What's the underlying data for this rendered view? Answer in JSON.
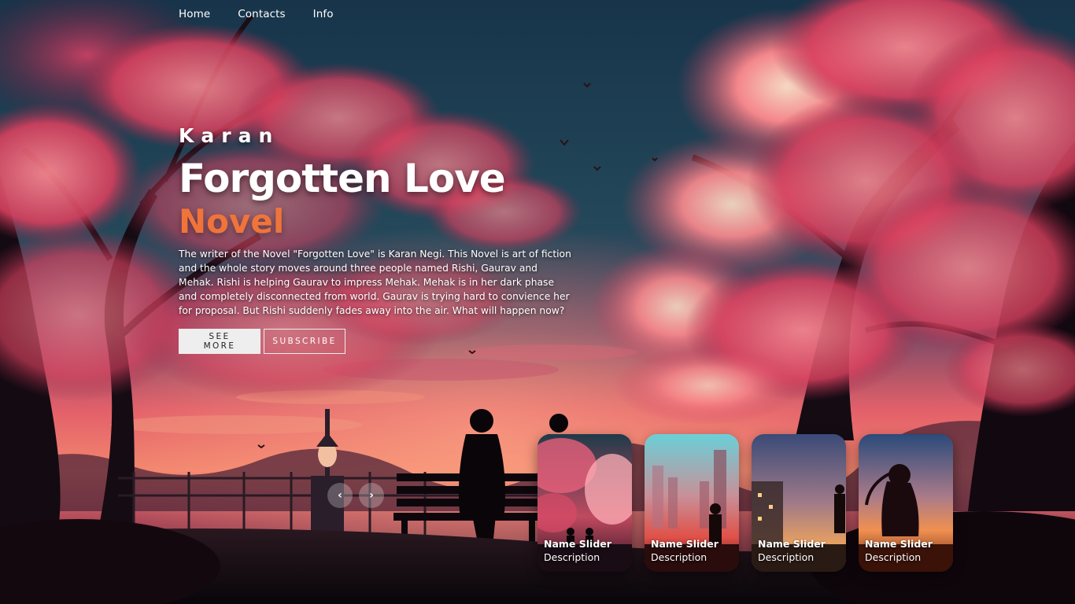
{
  "nav": {
    "items": [
      {
        "label": "Home"
      },
      {
        "label": "Contacts"
      },
      {
        "label": "Info"
      }
    ]
  },
  "hero": {
    "author": "Karan",
    "title": "Forgotten Love",
    "topic": "Novel",
    "description": "The writer of the Novel \"Forgotten Love\" is Karan Negi. This Novel is art of fiction and the whole story moves around three people named Rishi, Gaurav and Mehak. Rishi is helping Gaurav to impress Mehak. Mehak is in her dark phase and completely disconnected from world. Gaurav is trying hard to convience her for proposal. But Rishi suddenly fades away into the air. What will happen now?",
    "see_more_label": "SEE MORE",
    "subscribe_label": "SUBSCRIBE"
  },
  "arrows": {
    "prev_label": "‹",
    "next_label": "›"
  },
  "thumbnails": [
    {
      "title": "Name Slider",
      "description": "Description"
    },
    {
      "title": "Name Slider",
      "description": "Description"
    },
    {
      "title": "Name Slider",
      "description": "Description"
    },
    {
      "title": "Name Slider",
      "description": "Description"
    }
  ],
  "colors": {
    "accent": "#f0743a",
    "blossom": "#e0506a",
    "sky_dark": "#1c3b4a",
    "sunset": "#f07a6a"
  }
}
